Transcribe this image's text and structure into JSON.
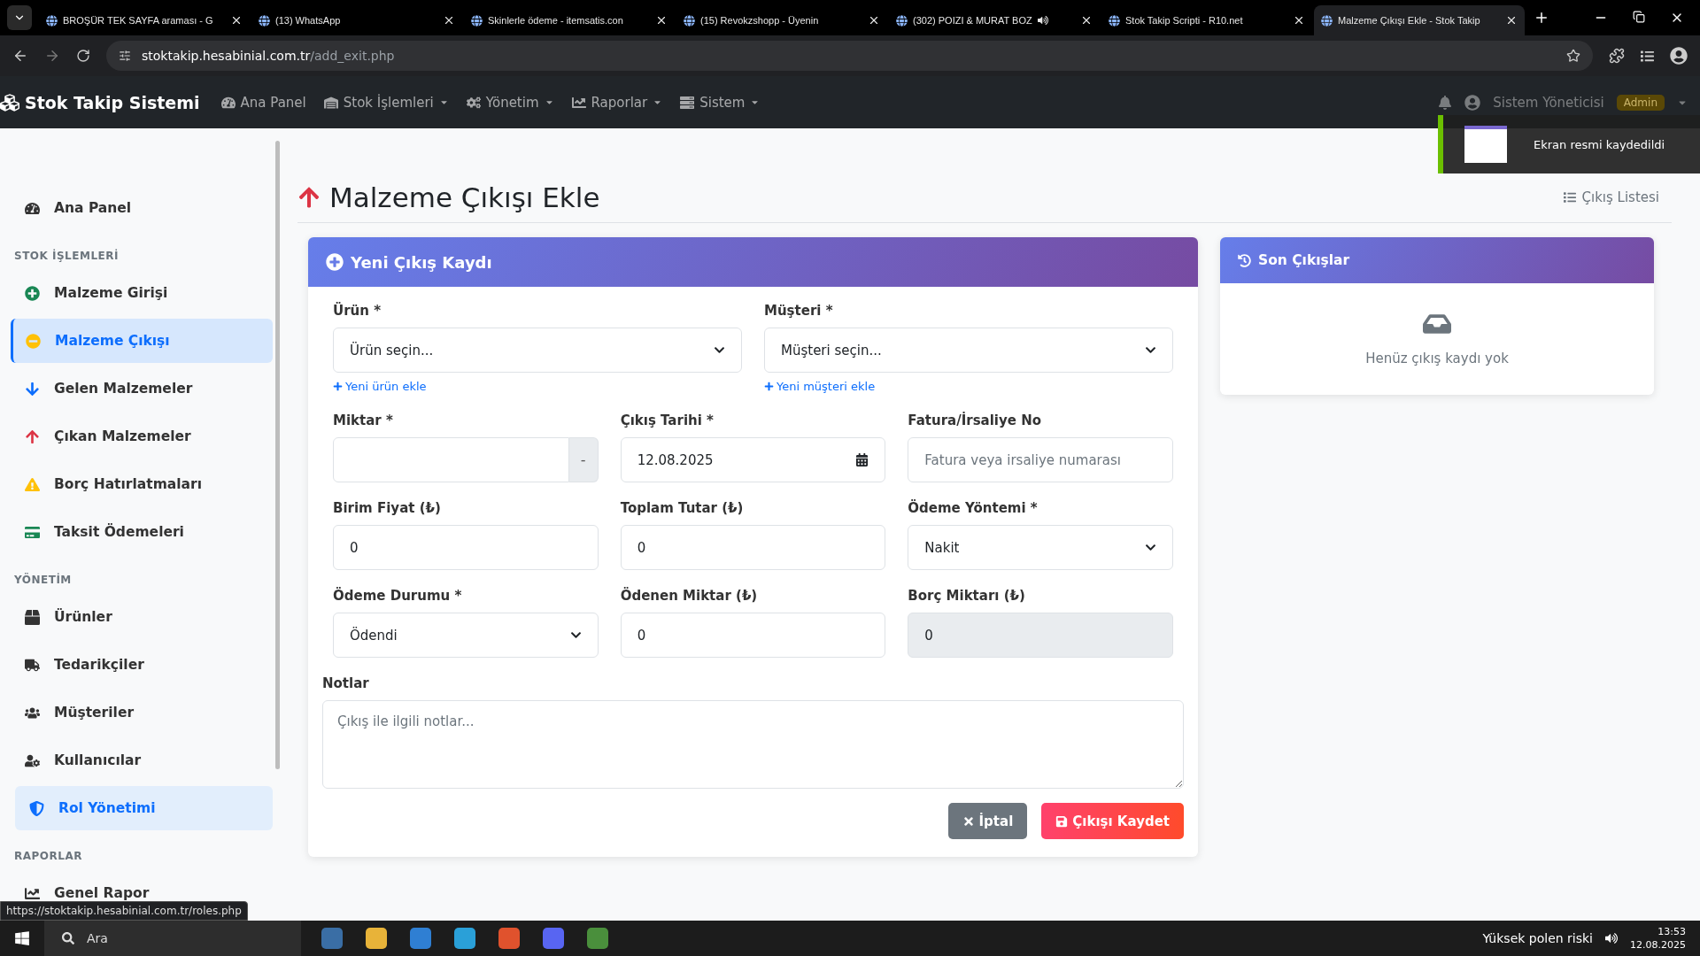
{
  "browser": {
    "tabs": [
      {
        "title": "BROŞÜR TEK SAYFA araması - G",
        "selected": false,
        "playing_audio": false
      },
      {
        "title": "(13) WhatsApp",
        "selected": false,
        "playing_audio": false
      },
      {
        "title": "Skinlerle ödeme - itemsatis.con",
        "selected": false,
        "playing_audio": false
      },
      {
        "title": "(15) Revokzshopp - Üyenin",
        "selected": false,
        "playing_audio": false
      },
      {
        "title": "(302) POIZI & MURAT BOZ",
        "selected": false,
        "playing_audio": true
      },
      {
        "title": "Stok Takip Scripti - R10.net",
        "selected": false,
        "playing_audio": false
      },
      {
        "title": "Malzeme Çıkışı Ekle - Stok Takip",
        "selected": true,
        "playing_audio": false
      }
    ],
    "address": {
      "host": "stoktakip.hesabinial.com.tr",
      "path": "/add_exit.php"
    },
    "status_link": "https://stoktakip.hesabinial.com.tr/roles.php"
  },
  "navbar": {
    "brand": "Stok Takip Sistemi",
    "items": [
      {
        "label": "Ana Panel",
        "has_dropdown": false
      },
      {
        "label": "Stok İşlemleri",
        "has_dropdown": true
      },
      {
        "label": "Yönetim",
        "has_dropdown": true
      },
      {
        "label": "Raporlar",
        "has_dropdown": true
      },
      {
        "label": "Sistem",
        "has_dropdown": true
      }
    ],
    "user": "Sistem Yöneticisi",
    "role_badge": "Admin"
  },
  "toast": {
    "message": "Ekran resmi kaydedildi"
  },
  "sidebar": {
    "sections": [
      {
        "items": [
          {
            "label": "Ana Panel",
            "selected": false,
            "hovered": false
          }
        ]
      },
      {
        "title": "STOK İŞLEMLERİ",
        "items": [
          {
            "label": "Malzeme Girişi",
            "selected": false,
            "hovered": false
          },
          {
            "label": "Malzeme Çıkışı",
            "selected": true,
            "hovered": false
          },
          {
            "label": "Gelen Malzemeler",
            "selected": false,
            "hovered": false
          },
          {
            "label": "Çıkan Malzemeler",
            "selected": false,
            "hovered": false
          },
          {
            "label": "Borç Hatırlatmaları",
            "selected": false,
            "hovered": false
          },
          {
            "label": "Taksit Ödemeleri",
            "selected": false,
            "hovered": false
          }
        ]
      },
      {
        "title": "YÖNETİM",
        "items": [
          {
            "label": "Ürünler",
            "selected": false,
            "hovered": false
          },
          {
            "label": "Tedarikçiler",
            "selected": false,
            "hovered": false
          },
          {
            "label": "Müşteriler",
            "selected": false,
            "hovered": false
          },
          {
            "label": "Kullanıcılar",
            "selected": false,
            "hovered": false
          },
          {
            "label": "Rol Yönetimi",
            "selected": false,
            "hovered": true
          }
        ]
      },
      {
        "title": "RAPORLAR",
        "items": [
          {
            "label": "Genel Rapor",
            "selected": false,
            "hovered": false
          }
        ]
      }
    ]
  },
  "page": {
    "title": "Malzeme Çıkışı Ekle",
    "list_link": "Çıkış Listesi"
  },
  "form": {
    "title": "Yeni Çıkış Kaydı",
    "rows": [
      [
        {
          "kind": "select",
          "label": "Ürün *",
          "value": "Ürün seçin...",
          "link": "Yeni ürün ekle"
        },
        {
          "kind": "select",
          "label": "Müşteri *",
          "value": "Müşteri seçin...",
          "link": "Yeni müşteri ekle"
        }
      ],
      [
        {
          "kind": "number",
          "label": "Miktar *",
          "addon": "-"
        },
        {
          "kind": "date",
          "label": "Çıkış Tarihi *",
          "value": "12.08.2025"
        },
        {
          "kind": "text",
          "label": "Fatura/İrsaliye No",
          "placeholder": "Fatura veya irsaliye numarası"
        }
      ],
      [
        {
          "kind": "text",
          "label": "Birim Fiyat (₺)",
          "value": "0"
        },
        {
          "kind": "text",
          "label": "Toplam Tutar (₺)",
          "value": "0"
        },
        {
          "kind": "select",
          "label": "Ödeme Yöntemi *",
          "value": "Nakit"
        }
      ],
      [
        {
          "kind": "select",
          "label": "Ödeme Durumu *",
          "value": "Ödendi"
        },
        {
          "kind": "text",
          "label": "Ödenen Miktar (₺)",
          "value": "0"
        },
        {
          "kind": "readonly",
          "label": "Borç Miktarı (₺)",
          "value": "0"
        }
      ]
    ],
    "notes": {
      "label": "Notlar",
      "placeholder": "Çıkış ile ilgili notlar..."
    },
    "buttons": [
      {
        "kind": "cancel",
        "label": "İptal"
      },
      {
        "kind": "save",
        "label": "Çıkışı Kaydet"
      }
    ]
  },
  "recent": {
    "title": "Son Çıkışlar",
    "empty_text": "Henüz çıkış kaydı yok"
  },
  "taskbar": {
    "search": "Ara",
    "weather": "Yüksek polen riski",
    "time": "13:53",
    "date": "12.08.2025"
  }
}
